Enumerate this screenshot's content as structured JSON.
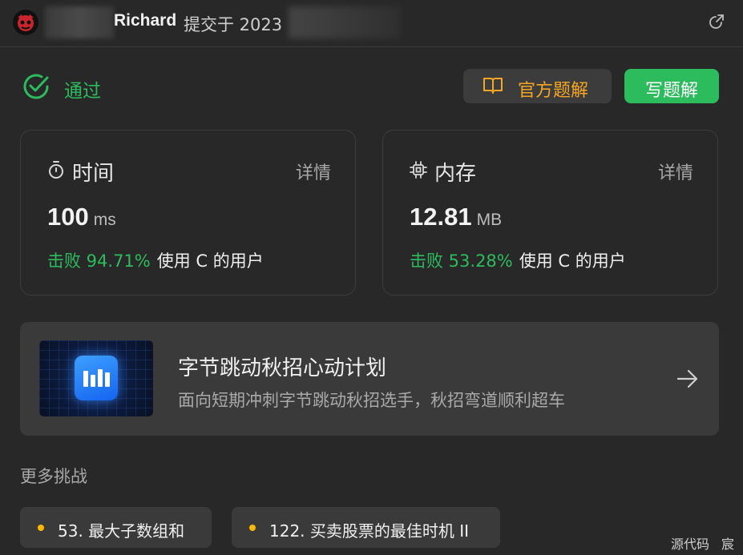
{
  "header": {
    "author": "Richard",
    "submitted_label": "提交于 2023"
  },
  "status": {
    "label": "通过",
    "color": "#2cbb5d"
  },
  "actions": {
    "official_solution": "官方题解",
    "write_solution": "写题解"
  },
  "time_card": {
    "title": "时间",
    "detail": "详情",
    "value": "100",
    "unit": "ms",
    "beat": "击败 94.71%",
    "beat_suffix": "使用 C 的用户"
  },
  "memory_card": {
    "title": "内存",
    "detail": "详情",
    "value": "12.81",
    "unit": "MB",
    "beat": "击败 53.28%",
    "beat_suffix": "使用 C 的用户"
  },
  "banner": {
    "title": "字节跳动秋招心动计划",
    "subtitle": "面向短期冲刺字节跳动秋招选手，秋招弯道顺利超车"
  },
  "more": {
    "title": "更多挑战",
    "items": [
      {
        "label": "53. 最大子数组和"
      },
      {
        "label": "122. 买卖股票的最佳时机 II"
      }
    ]
  },
  "footer": {
    "source_code": "源代码",
    "extra": "宸"
  },
  "colors": {
    "accent_green": "#2cbb5d",
    "accent_orange": "#f5a623",
    "background": "#282828"
  }
}
